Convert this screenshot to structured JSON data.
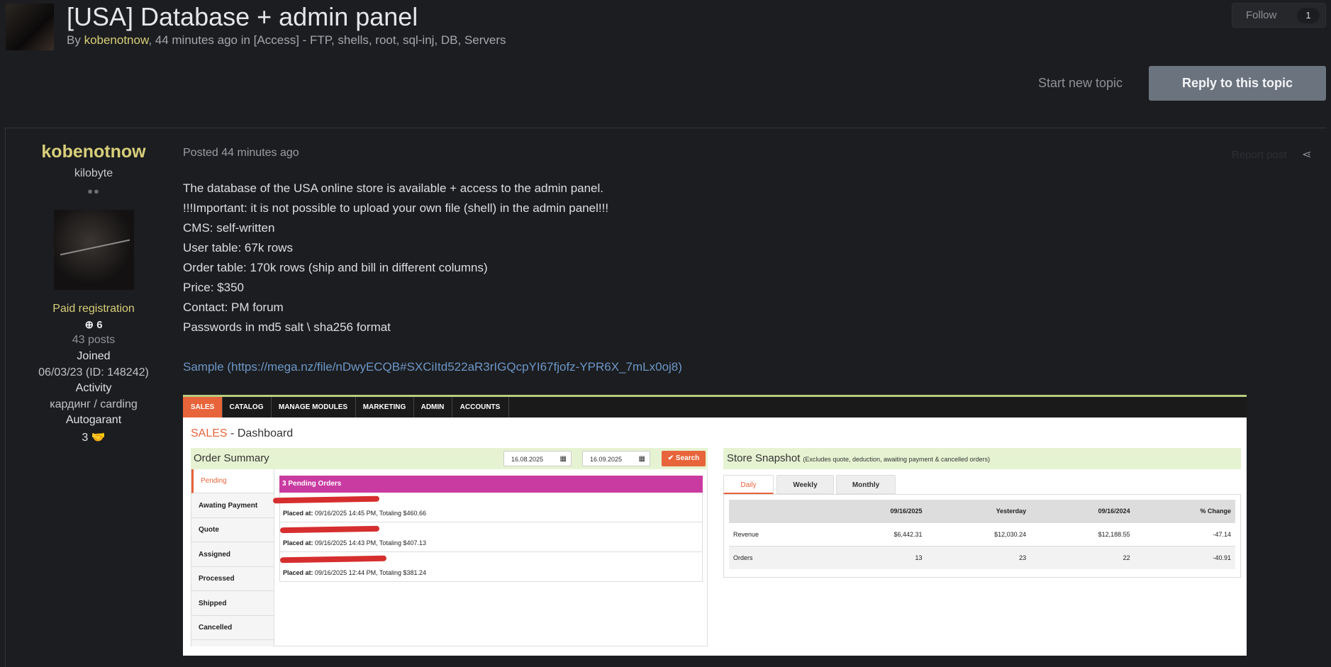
{
  "topic": {
    "title": "[USA] Database + admin panel",
    "by_prefix": "By ",
    "author": "kobenotnow",
    "byline_rest": ", 44 minutes ago in [Access] - FTP, shells, root, sql-inj, DB, Servers"
  },
  "follow": {
    "label": "Follow",
    "count": "1"
  },
  "actions": {
    "start_topic": "Start new topic",
    "reply": "Reply to this topic"
  },
  "author": {
    "name": "kobenotnow",
    "rank": "kilobyte",
    "pips": "●●",
    "group": "Paid registration",
    "reputation": "6",
    "posts": "43 posts",
    "joined_label": "Joined",
    "joined_value": "06/03/23 (ID: 148242)",
    "activity_label": "Activity",
    "activity_value": "кардинг / carding",
    "autogarant_label": "Autogarant",
    "autogarant_value": "3"
  },
  "post": {
    "posted": "Posted 44 minutes ago",
    "report": "Report post",
    "lines": [
      "The database of the USA online store is available + access to the admin panel.",
      "!!!Important: it is not possible to upload your own file (shell) in the admin panel!!!",
      "CMS: self-written",
      "User table: 67k rows",
      "Order table: 170k rows (ship and bill in different columns)",
      "Price: $350",
      "Contact: PM forum",
      "Passwords in md5 salt \\ sha256 format"
    ],
    "sample_link": "Sample (https://mega.nz/file/nDwyECQB#SXCiItd522aR3rIGQcpYI67fjofz-YPR6X_7mLx0oj8)"
  },
  "admin": {
    "nav": [
      "SALES",
      "CATALOG",
      "MANAGE MODULES",
      "MARKETING",
      "ADMIN",
      "ACCOUNTS"
    ],
    "dash_sales": "SALES",
    "dash_rest": " - Dashboard",
    "order_summary": {
      "title": "Order Summary",
      "date_from": "16.08.2025",
      "date_to": "16.09.2025",
      "search": "Search",
      "tabs": [
        "Pending",
        "Awating Payment",
        "Quote",
        "Assigned",
        "Processed",
        "Shipped",
        "Cancelled"
      ],
      "pending_header": "3 Pending Orders",
      "orders": [
        {
          "label": "Placed at:",
          "text": " 09/16/2025 14:45 PM, Totaling $460.66"
        },
        {
          "label": "Placed at:",
          "text": " 09/16/2025 14:43 PM, Totaling $407.13"
        },
        {
          "label": "Placed at:",
          "text": " 09/16/2025 12:44 PM, Totaling $381.24"
        }
      ]
    },
    "snapshot": {
      "title": "Store Snapshot",
      "subtitle": "(Excludes quote, deduction, awaiting payment & cancelled orders)",
      "tabs": [
        "Daily",
        "Weekly",
        "Monthly"
      ],
      "headers": [
        "",
        "09/16/2025",
        "Yesterday",
        "09/16/2024",
        "% Change"
      ],
      "rows": [
        [
          "Revenue",
          "$6,442.31",
          "$12,030.24",
          "$12,188.55",
          "-47.14"
        ],
        [
          "Orders",
          "13",
          "23",
          "22",
          "-40.91"
        ]
      ]
    }
  }
}
